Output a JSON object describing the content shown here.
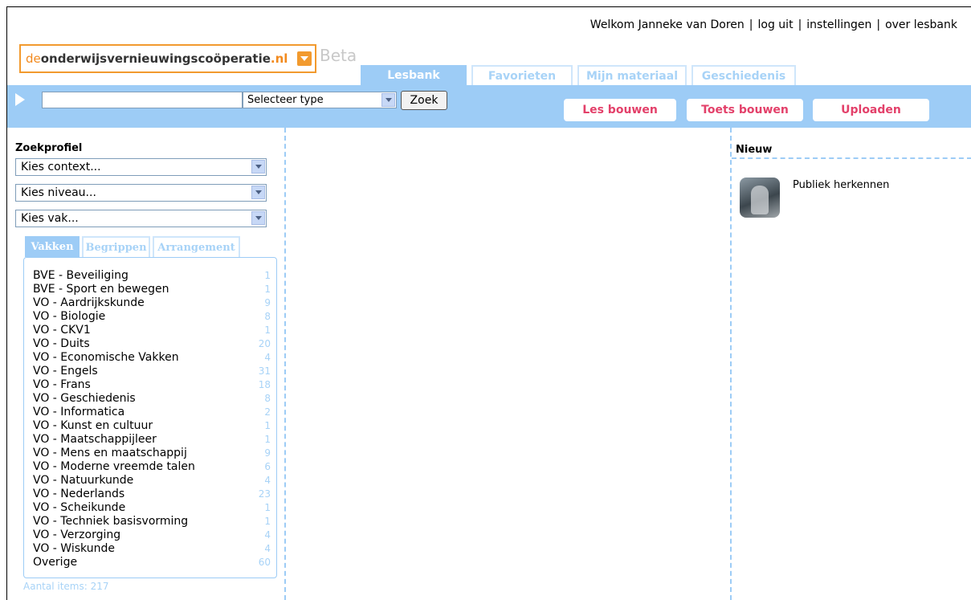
{
  "header": {
    "welcome": "Welkom Janneke van Doren",
    "logout": "log uit",
    "settings": "instellingen",
    "about": "over lesbank",
    "sep": "|"
  },
  "logo": {
    "part_de": "de",
    "part_main": "onderwijsvernieuwingscoöperatie",
    "part_nl": ".nl",
    "beta": "Beta"
  },
  "tabs": [
    "Lesbank",
    "Favorieten",
    "Mijn materiaal",
    "Geschiedenis"
  ],
  "search": {
    "value": "",
    "type_label": "Selecteer type",
    "zoek": "Zoek"
  },
  "actions": [
    "Les bouwen",
    "Toets bouwen",
    "Uploaden"
  ],
  "left": {
    "title": "Zoekprofiel",
    "dropdowns": [
      "Kies context...",
      "Kies niveau...",
      "Kies vak..."
    ],
    "subtabs": [
      "Vakken",
      "Begrippen",
      "Arrangement"
    ],
    "items": [
      {
        "name": "BVE - Beveiliging",
        "count": "1"
      },
      {
        "name": "BVE - Sport en bewegen",
        "count": "1"
      },
      {
        "name": "VO - Aardrijkskunde",
        "count": "9"
      },
      {
        "name": "VO - Biologie",
        "count": "8"
      },
      {
        "name": "VO - CKV1",
        "count": "1"
      },
      {
        "name": "VO - Duits",
        "count": "20"
      },
      {
        "name": "VO - Economische Vakken",
        "count": "4"
      },
      {
        "name": "VO - Engels",
        "count": "31"
      },
      {
        "name": "VO - Frans",
        "count": "18"
      },
      {
        "name": "VO - Geschiedenis",
        "count": "8"
      },
      {
        "name": "VO - Informatica",
        "count": "2"
      },
      {
        "name": "VO - Kunst en cultuur",
        "count": "1"
      },
      {
        "name": "VO - Maatschappijleer",
        "count": "1"
      },
      {
        "name": "VO - Mens en maatschappij",
        "count": "9"
      },
      {
        "name": "VO - Moderne vreemde talen",
        "count": "6"
      },
      {
        "name": "VO - Natuurkunde",
        "count": "4"
      },
      {
        "name": "VO - Nederlands",
        "count": "23"
      },
      {
        "name": "VO - Scheikunde",
        "count": "1"
      },
      {
        "name": "VO - Techniek basisvorming",
        "count": "1"
      },
      {
        "name": "VO - Verzorging",
        "count": "4"
      },
      {
        "name": "VO - Wiskunde",
        "count": "4"
      },
      {
        "name": "Overige",
        "count": "60"
      }
    ],
    "aantal": "Aantal items: 217"
  },
  "right": {
    "title": "Nieuw",
    "items": [
      {
        "title": "Publiek herkennen"
      }
    ]
  }
}
